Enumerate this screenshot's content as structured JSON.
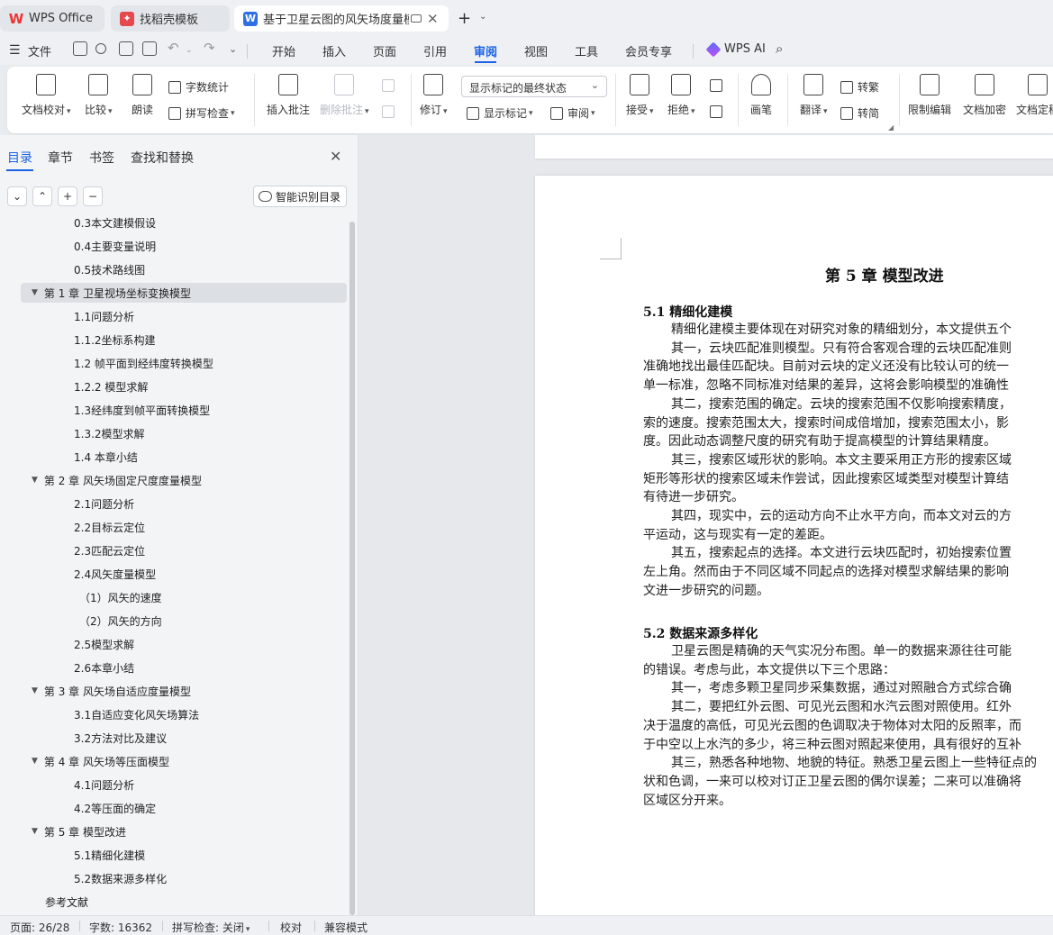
{
  "tabs": {
    "wps_office": "WPS Office",
    "daoke": "找稻壳模板",
    "document": "基于卫星云图的风矢场度量模型",
    "new_tab": "+"
  },
  "menu": {
    "file": "文件",
    "items": [
      "开始",
      "插入",
      "页面",
      "引用",
      "审阅",
      "视图",
      "工具",
      "会员专享"
    ],
    "active": "审阅",
    "wps_ai": "WPS AI"
  },
  "ribbon": {
    "doc_proofread": "文档校对",
    "compare": "比较",
    "read_aloud": "朗读",
    "word_count": "字数统计",
    "spell_check": "拼写检查",
    "insert_comment": "插入批注",
    "delete_comment": "删除批注",
    "revise": "修订",
    "markup_state": "显示标记的最终状态",
    "show_markup": "显示标记",
    "review_pane": "审阅",
    "accept": "接受",
    "reject": "拒绝",
    "brush": "画笔",
    "translate": "翻译",
    "to_traditional": "转繁",
    "to_simplified": "转简",
    "restrict_edit": "限制编辑",
    "doc_encrypt": "文档加密",
    "doc_final": "文档定稿"
  },
  "nav": {
    "tabs": [
      "目录",
      "章节",
      "书签",
      "查找和替换"
    ],
    "smart_toc": "智能识别目录",
    "toc": [
      {
        "label": "0.3本文建模假设"
      },
      {
        "label": "0.4主要变量说明"
      },
      {
        "label": "0.5技术路线图"
      },
      {
        "label": "第 1 章 卫星视场坐标变换模型",
        "expandable": true,
        "selected": true
      },
      {
        "label": "1.1问题分析"
      },
      {
        "label": "1.1.2坐标系构建"
      },
      {
        "label": "1.2 帧平面到经纬度转换模型"
      },
      {
        "label": "1.2.2 模型求解"
      },
      {
        "label": "1.3经纬度到帧平面转换模型"
      },
      {
        "label": "1.3.2模型求解"
      },
      {
        "label": "1.4 本章小结"
      },
      {
        "label": "第 2 章 风矢场固定尺度度量模型",
        "expandable": true
      },
      {
        "label": "2.1问题分析"
      },
      {
        "label": "2.2目标云定位"
      },
      {
        "label": "2.3匹配云定位"
      },
      {
        "label": "2.4风矢度量模型"
      },
      {
        "label": "（1）风矢的速度"
      },
      {
        "label": "（2）风矢的方向"
      },
      {
        "label": "2.5模型求解"
      },
      {
        "label": "2.6本章小结"
      },
      {
        "label": "第 3 章 风矢场自适应度量模型",
        "expandable": true
      },
      {
        "label": "3.1自适应变化风矢场算法"
      },
      {
        "label": "3.2方法对比及建议"
      },
      {
        "label": "第 4 章 风矢场等压面模型",
        "expandable": true
      },
      {
        "label": "4.1问题分析"
      },
      {
        "label": "4.2等压面的确定"
      },
      {
        "label": "第 5 章 模型改进",
        "expandable": true
      },
      {
        "label": "5.1精细化建模"
      },
      {
        "label": "5.2数据来源多样化"
      },
      {
        "label": "参考文献"
      }
    ]
  },
  "document": {
    "chapter_title": "第 5 章  模型改进",
    "section1_title": "5.1  精细化建模",
    "section1_lines": [
      "精细化建模主要体现在对研究对象的精细划分，本文提供五个",
      "其一，云块匹配准则模型。只有符合客观合理的云块匹配准则",
      "准确地找出最佳匹配块。目前对云块的定义还没有比较认可的统一",
      "单一标准，忽略不同标准对结果的差异，这将会影响模型的准确性",
      "其二，搜索范围的确定。云块的搜索范围不仅影响搜索精度，",
      "索的速度。搜索范围太大，搜索时间成倍增加，搜索范围太小，影",
      "度。因此动态调整尺度的研究有助于提高模型的计算结果精度。",
      "其三，搜索区域形状的影响。本文主要采用正方形的搜索区域",
      "矩形等形状的搜索区域未作尝试，因此搜索区域类型对模型计算结",
      "有待进一步研究。",
      "其四，现实中，云的运动方向不止水平方向，而本文对云的方",
      "平运动，这与现实有一定的差距。",
      "其五，搜索起点的选择。本文进行云块匹配时，初始搜索位置",
      "左上角。然而由于不同区域不同起点的选择对模型求解结果的影响",
      "文进一步研究的问题。"
    ],
    "section1_indent": [
      true,
      true,
      false,
      false,
      true,
      false,
      false,
      true,
      false,
      false,
      true,
      false,
      true,
      false,
      false
    ],
    "section2_title": "5.2  数据来源多样化",
    "section2_lines": [
      "卫星云图是精确的天气实况分布图。单一的数据来源往往可能",
      "的错误。考虑与此，本文提供以下三个思路：",
      "其一，考虑多颗卫星同步采集数据，通过对照融合方式综合确",
      "其二，要把红外云图、可见光云图和水汽云图对照使用。红外",
      "决于温度的高低，可见光云图的色调取决于物体对太阳的反照率，而",
      "于中空以上水汽的多少，将三种云图对照起来使用，具有很好的互补",
      "其三，熟悉各种地物、地貌的特征。熟悉卫星云图上一些特征点的",
      "状和色调，一来可以校对订正卫星云图的偶尔误差；二来可以准确将",
      "区域区分开来。"
    ],
    "section2_indent": [
      true,
      false,
      true,
      true,
      false,
      false,
      true,
      false,
      false
    ]
  },
  "status": {
    "page": "页面: 26/28",
    "word_count": "字数: 16362",
    "spell_check": "拼写检查: 关闭",
    "proofread": "校对",
    "compat_mode": "兼容模式"
  },
  "colors": {
    "accent": "#1a62e6",
    "wps_logo": "#e33333",
    "daoke_logo": "#e5484d",
    "doc_logo": "#2f6fe4"
  }
}
